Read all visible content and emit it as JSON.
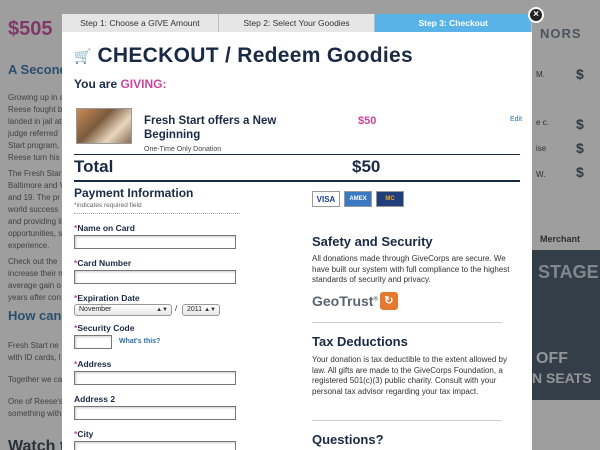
{
  "background_page": {
    "amount": "$505",
    "heading": "A Second",
    "para_lines": [
      "Growing up in a",
      "Reese fought b",
      "landed in jail at",
      "judge referred",
      "Start program,",
      "Reese turn his"
    ],
    "para2_lines": [
      "The Fresh Star",
      "Baltimore and V",
      "and 19. The pr",
      "world success",
      "and providing li",
      "opportunities, s",
      "experience."
    ],
    "para3_lines": [
      "Check out the",
      "increase their n",
      "average gain o",
      "years after con"
    ],
    "how_can": "How can y",
    "para4_lines": [
      "Fresh Start ne",
      "with ID cards, l"
    ],
    "para5": "Together we ca",
    "para6_lines": [
      "One of Reese's",
      "something with"
    ],
    "watch": "Watch the",
    "donors_heading": "NORS",
    "donor_amounts": [
      "$",
      "$",
      "$",
      "$"
    ],
    "donor_texts": [
      "M.",
      "e c.",
      "ise",
      "W."
    ],
    "merchant": "Merchant",
    "poster_stage": "STAGE",
    "poster_off": "OFF",
    "poster_seats": "N SEATS"
  },
  "steps": [
    {
      "label": "Step 1: Choose a GIVE Amount",
      "active": false
    },
    {
      "label": "Step 2: Select Your Goodies",
      "active": false
    },
    {
      "label": "Step 3: Checkout",
      "active": true
    }
  ],
  "close_label": "×",
  "title": "CHECKOUT / Redeem Goodies",
  "giving_prefix": "You are ",
  "giving_word": "GIVING:",
  "item": {
    "name": "Fresh Start offers a New Beginning",
    "subtitle": "One-Time Only Donation",
    "price": "$50",
    "edit": "Edit"
  },
  "total": {
    "label": "Total",
    "value": "$50"
  },
  "payment": {
    "heading": "Payment Information",
    "required_note": "*indicates required field",
    "fields": {
      "name_on_card": {
        "star": "*",
        "label": "Name on Card",
        "value": ""
      },
      "card_number": {
        "star": "*",
        "label": "Card Number",
        "value": ""
      },
      "expiration": {
        "star": "*",
        "label": "Expiration Date",
        "month": "November",
        "year": "2011",
        "sep": "/"
      },
      "security_code": {
        "star": "*",
        "label": "Security Code",
        "value": "",
        "help": "What's this?"
      },
      "address": {
        "star": "*",
        "label": "Address",
        "value": ""
      },
      "address2": {
        "star": "",
        "label": "Address 2",
        "value": ""
      },
      "city": {
        "star": "*",
        "label": "City",
        "value": ""
      }
    }
  },
  "cards": [
    "VISA",
    "AMEX",
    "MC"
  ],
  "safety": {
    "heading": "Safety and Security",
    "text": "All donations made through GiveCorps are secure. We have built our system with full compliance to the highest standards of security and privacy.",
    "geotrust": "GeoTrust",
    "geotrust_mark": "®"
  },
  "tax": {
    "heading": "Tax Deductions",
    "text": "Your donation is tax deductible to the extent allowed by law. All gifts are made to the GiveCorps Foundation, a registered 501(c)(3) public charity. Consult with your personal tax advisor regarding your tax impact."
  },
  "questions": {
    "heading": "Questions?"
  },
  "colors": {
    "accent_pink": "#c7469b",
    "navy": "#1a2a44",
    "step_active": "#5ab3e6",
    "link": "#2d6fa5"
  }
}
